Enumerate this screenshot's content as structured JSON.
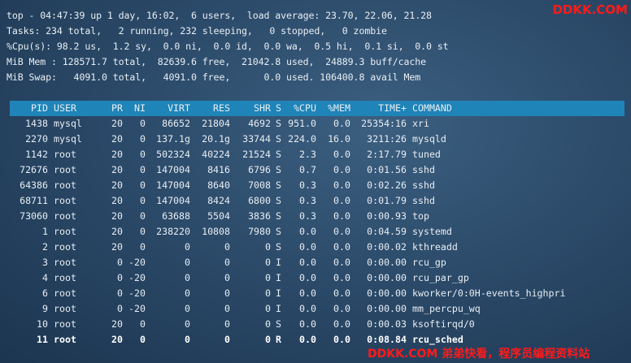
{
  "summary": {
    "line1": "top - 04:47:39 up 1 day, 16:02,  6 users,  load average: 23.70, 22.06, 21.28",
    "line2": "Tasks: 234 total,   2 running, 232 sleeping,   0 stopped,   0 zombie",
    "line3": "%Cpu(s): 98.2 us,  1.2 sy,  0.0 ni,  0.0 id,  0.0 wa,  0.5 hi,  0.1 si,  0.0 st",
    "line4": "MiB Mem : 128571.7 total,  82639.6 free,  21042.8 used,  24889.3 buff/cache",
    "line5": "MiB Swap:   4091.0 total,   4091.0 free,      0.0 used. 106400.8 avail Mem"
  },
  "columns": {
    "pid": "PID",
    "user": "USER",
    "pr": "PR",
    "ni": "NI",
    "virt": "VIRT",
    "res": "RES",
    "shr": "SHR",
    "s": "S",
    "cpu": "%CPU",
    "mem": "%MEM",
    "time": "TIME+",
    "command": "COMMAND"
  },
  "processes": [
    {
      "pid": "1438",
      "user": "mysql",
      "pr": "20",
      "ni": "0",
      "virt": "86652",
      "res": "21804",
      "shr": "4692",
      "s": "S",
      "cpu": "951.0",
      "mem": "0.0",
      "time": "25354:16",
      "command": "xri"
    },
    {
      "pid": "2270",
      "user": "mysql",
      "pr": "20",
      "ni": "0",
      "virt": "137.1g",
      "res": "20.1g",
      "shr": "33744",
      "s": "S",
      "cpu": "224.0",
      "mem": "16.0",
      "time": "3211:26",
      "command": "mysqld"
    },
    {
      "pid": "1142",
      "user": "root",
      "pr": "20",
      "ni": "0",
      "virt": "502324",
      "res": "40224",
      "shr": "21524",
      "s": "S",
      "cpu": "2.3",
      "mem": "0.0",
      "time": "2:17.79",
      "command": "tuned"
    },
    {
      "pid": "72676",
      "user": "root",
      "pr": "20",
      "ni": "0",
      "virt": "147004",
      "res": "8416",
      "shr": "6796",
      "s": "S",
      "cpu": "0.7",
      "mem": "0.0",
      "time": "0:01.56",
      "command": "sshd"
    },
    {
      "pid": "64386",
      "user": "root",
      "pr": "20",
      "ni": "0",
      "virt": "147004",
      "res": "8640",
      "shr": "7008",
      "s": "S",
      "cpu": "0.3",
      "mem": "0.0",
      "time": "0:02.26",
      "command": "sshd"
    },
    {
      "pid": "68711",
      "user": "root",
      "pr": "20",
      "ni": "0",
      "virt": "147004",
      "res": "8424",
      "shr": "6800",
      "s": "S",
      "cpu": "0.3",
      "mem": "0.0",
      "time": "0:01.79",
      "command": "sshd"
    },
    {
      "pid": "73060",
      "user": "root",
      "pr": "20",
      "ni": "0",
      "virt": "63688",
      "res": "5504",
      "shr": "3836",
      "s": "S",
      "cpu": "0.3",
      "mem": "0.0",
      "time": "0:00.93",
      "command": "top"
    },
    {
      "pid": "1",
      "user": "root",
      "pr": "20",
      "ni": "0",
      "virt": "238220",
      "res": "10808",
      "shr": "7980",
      "s": "S",
      "cpu": "0.0",
      "mem": "0.0",
      "time": "0:04.59",
      "command": "systemd"
    },
    {
      "pid": "2",
      "user": "root",
      "pr": "20",
      "ni": "0",
      "virt": "0",
      "res": "0",
      "shr": "0",
      "s": "S",
      "cpu": "0.0",
      "mem": "0.0",
      "time": "0:00.02",
      "command": "kthreadd"
    },
    {
      "pid": "3",
      "user": "root",
      "pr": "0",
      "ni": "-20",
      "virt": "0",
      "res": "0",
      "shr": "0",
      "s": "I",
      "cpu": "0.0",
      "mem": "0.0",
      "time": "0:00.00",
      "command": "rcu_gp"
    },
    {
      "pid": "4",
      "user": "root",
      "pr": "0",
      "ni": "-20",
      "virt": "0",
      "res": "0",
      "shr": "0",
      "s": "I",
      "cpu": "0.0",
      "mem": "0.0",
      "time": "0:00.00",
      "command": "rcu_par_gp"
    },
    {
      "pid": "6",
      "user": "root",
      "pr": "0",
      "ni": "-20",
      "virt": "0",
      "res": "0",
      "shr": "0",
      "s": "I",
      "cpu": "0.0",
      "mem": "0.0",
      "time": "0:00.00",
      "command": "kworker/0:0H-events_highpri"
    },
    {
      "pid": "9",
      "user": "root",
      "pr": "0",
      "ni": "-20",
      "virt": "0",
      "res": "0",
      "shr": "0",
      "s": "I",
      "cpu": "0.0",
      "mem": "0.0",
      "time": "0:00.00",
      "command": "mm_percpu_wq"
    },
    {
      "pid": "10",
      "user": "root",
      "pr": "20",
      "ni": "0",
      "virt": "0",
      "res": "0",
      "shr": "0",
      "s": "S",
      "cpu": "0.0",
      "mem": "0.0",
      "time": "0:00.03",
      "command": "ksoftirqd/0"
    },
    {
      "pid": "11",
      "user": "root",
      "pr": "20",
      "ni": "0",
      "virt": "0",
      "res": "0",
      "shr": "0",
      "s": "R",
      "cpu": "0.0",
      "mem": "0.0",
      "time": "0:08.84",
      "command": "rcu_sched",
      "bold": true
    }
  ],
  "watermarks": {
    "top": "DDKK.COM",
    "bottom": "DDKK.COM 弟弟快看，程序员编程资料站"
  },
  "colors": {
    "header_bg": "#1f84b8",
    "text": "#e8eef4",
    "watermark": "#ff1a1a"
  }
}
